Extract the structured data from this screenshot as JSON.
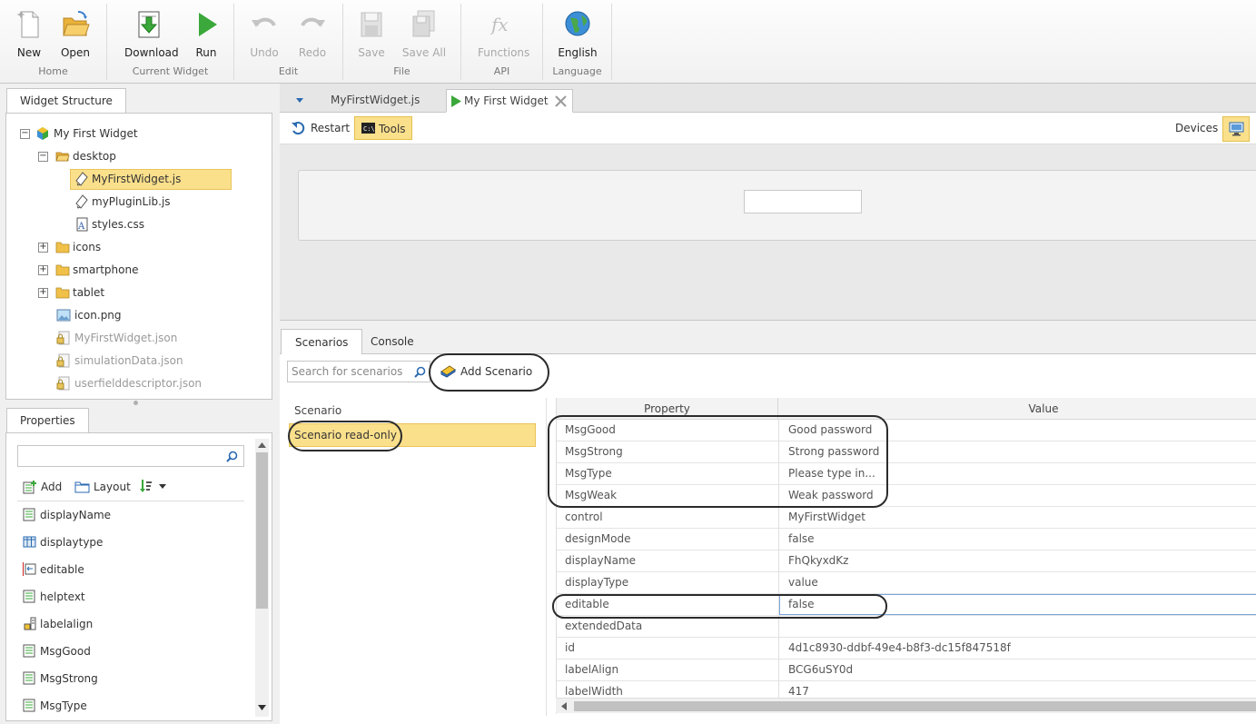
{
  "ribbon": {
    "groups": [
      {
        "name": "Home",
        "buttons": [
          {
            "label": "New"
          },
          {
            "label": "Open"
          }
        ]
      },
      {
        "name": "Current Widget",
        "buttons": [
          {
            "label": "Download"
          },
          {
            "label": "Run"
          }
        ]
      },
      {
        "name": "Edit",
        "buttons": [
          {
            "label": "Undo"
          },
          {
            "label": "Redo"
          }
        ]
      },
      {
        "name": "File",
        "buttons": [
          {
            "label": "Save"
          },
          {
            "label": "Save All"
          }
        ]
      },
      {
        "name": "API",
        "buttons": [
          {
            "label": "Functions"
          }
        ]
      },
      {
        "name": "Language",
        "buttons": [
          {
            "label": "English"
          }
        ]
      }
    ]
  },
  "widget_structure": {
    "tab": "Widget Structure",
    "items": [
      {
        "label": "My First Widget"
      },
      {
        "label": "desktop"
      },
      {
        "label": "MyFirstWidget.js"
      },
      {
        "label": "myPluginLib.js"
      },
      {
        "label": "styles.css"
      },
      {
        "label": "icons"
      },
      {
        "label": "smartphone"
      },
      {
        "label": "tablet"
      },
      {
        "label": "icon.png"
      },
      {
        "label": "MyFirstWidget.json"
      },
      {
        "label": "simulationData.json"
      },
      {
        "label": "userfielddescriptor.json"
      }
    ]
  },
  "properties": {
    "tab": "Properties",
    "search_placeholder": "",
    "toolbar": {
      "add": "Add",
      "layout": "Layout"
    },
    "items": [
      {
        "label": "displayName"
      },
      {
        "label": "displaytype"
      },
      {
        "label": "editable"
      },
      {
        "label": "helptext"
      },
      {
        "label": "labelalign"
      },
      {
        "label": "MsgGood"
      },
      {
        "label": "MsgStrong"
      },
      {
        "label": "MsgType"
      }
    ]
  },
  "doc_tabs": [
    {
      "label": "MyFirstWidget.js"
    },
    {
      "label": "My First Widget"
    }
  ],
  "toolbar": {
    "restart": "Restart",
    "tools": "Tools",
    "devices": "Devices"
  },
  "lower_tabs": [
    {
      "label": "Scenarios"
    },
    {
      "label": "Console"
    }
  ],
  "scenarios": {
    "search_placeholder": "Search for scenarios",
    "add_label": "Add Scenario",
    "column_header": "Scenario",
    "items": [
      {
        "label": "Scenario read-only"
      }
    ]
  },
  "grid": {
    "headers": {
      "property": "Property",
      "value": "Value"
    },
    "rows": [
      {
        "key": "MsgGood",
        "value": "Good password"
      },
      {
        "key": "MsgStrong",
        "value": "Strong password"
      },
      {
        "key": "MsgType",
        "value": "Please type in..."
      },
      {
        "key": "MsgWeak",
        "value": "Weak password"
      },
      {
        "key": "control",
        "value": "MyFirstWidget"
      },
      {
        "key": "designMode",
        "value": "false"
      },
      {
        "key": "displayName",
        "value": "FhQkyxdKz"
      },
      {
        "key": "displayType",
        "value": "value"
      },
      {
        "key": "editable",
        "value": "false"
      },
      {
        "key": "extendedData",
        "value": ""
      },
      {
        "key": "id",
        "value": "4d1c8930-ddbf-49e4-b8f3-dc15f847518f"
      },
      {
        "key": "labelAlign",
        "value": "BCG6uSY0d"
      },
      {
        "key": "labelWidth",
        "value": "417"
      }
    ]
  },
  "colors": {
    "selection": "#fbe08c",
    "run_green": "#3aa83a",
    "border": "#c6c6c6"
  }
}
